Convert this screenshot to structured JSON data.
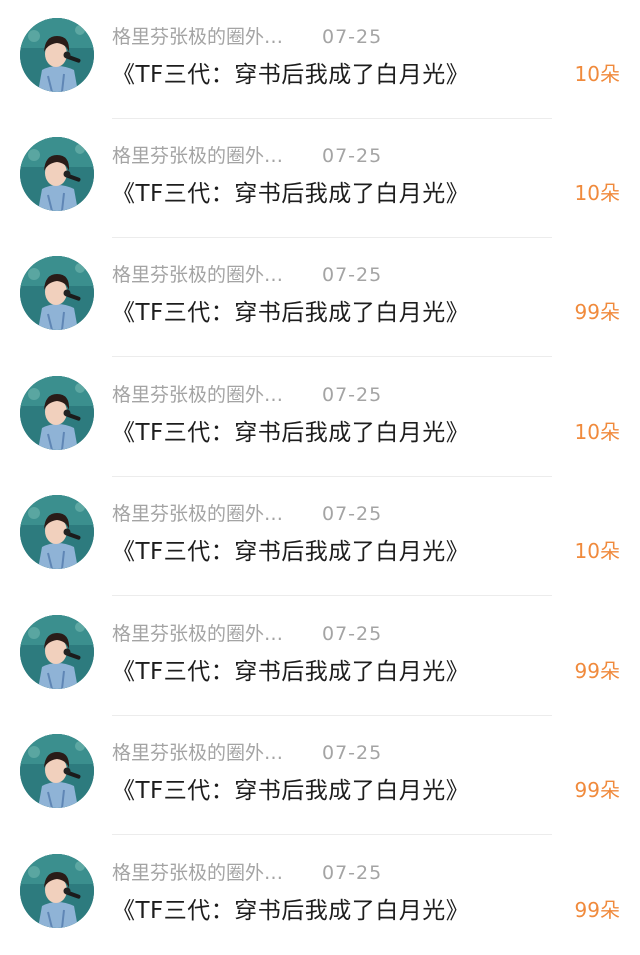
{
  "accent_color": "#f08a3c",
  "items": [
    {
      "author": "格里芬张极的圈外…",
      "date": "07-25",
      "title": "《TF三代：穿书后我成了白月光》",
      "count": "10朵",
      "avatar_icon": "avatar-photo-icon"
    },
    {
      "author": "格里芬张极的圈外…",
      "date": "07-25",
      "title": "《TF三代：穿书后我成了白月光》",
      "count": "10朵",
      "avatar_icon": "avatar-photo-icon"
    },
    {
      "author": "格里芬张极的圈外…",
      "date": "07-25",
      "title": "《TF三代：穿书后我成了白月光》",
      "count": "99朵",
      "avatar_icon": "avatar-photo-icon"
    },
    {
      "author": "格里芬张极的圈外…",
      "date": "07-25",
      "title": "《TF三代：穿书后我成了白月光》",
      "count": "10朵",
      "avatar_icon": "avatar-photo-icon"
    },
    {
      "author": "格里芬张极的圈外…",
      "date": "07-25",
      "title": "《TF三代：穿书后我成了白月光》",
      "count": "10朵",
      "avatar_icon": "avatar-photo-icon"
    },
    {
      "author": "格里芬张极的圈外…",
      "date": "07-25",
      "title": "《TF三代：穿书后我成了白月光》",
      "count": "99朵",
      "avatar_icon": "avatar-photo-icon"
    },
    {
      "author": "格里芬张极的圈外…",
      "date": "07-25",
      "title": "《TF三代：穿书后我成了白月光》",
      "count": "99朵",
      "avatar_icon": "avatar-photo-icon"
    },
    {
      "author": "格里芬张极的圈外…",
      "date": "07-25",
      "title": "《TF三代：穿书后我成了白月光》",
      "count": "99朵",
      "avatar_icon": "avatar-photo-icon"
    }
  ]
}
